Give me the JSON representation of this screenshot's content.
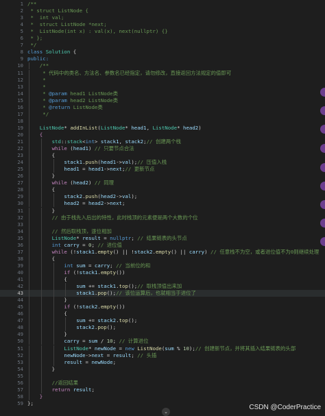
{
  "editor": {
    "current_line": 43,
    "lines": [
      {
        "n": 1,
        "indent": 0,
        "tokens": [
          [
            "/**",
            "cm"
          ]
        ]
      },
      {
        "n": 2,
        "indent": 0,
        "tokens": [
          [
            " * struct ListNode {",
            "cm"
          ]
        ]
      },
      {
        "n": 3,
        "indent": 0,
        "tokens": [
          [
            " *  int val;",
            "cm"
          ]
        ]
      },
      {
        "n": 4,
        "indent": 0,
        "tokens": [
          [
            " *  struct ListNode *next;",
            "cm"
          ]
        ]
      },
      {
        "n": 5,
        "indent": 0,
        "tokens": [
          [
            " *  ListNode(int x) : val(x), next(nullptr) {}",
            "cm"
          ]
        ]
      },
      {
        "n": 6,
        "indent": 0,
        "tokens": [
          [
            " * };",
            "cm"
          ]
        ]
      },
      {
        "n": 7,
        "indent": 0,
        "tokens": [
          [
            " */",
            "cm"
          ]
        ]
      },
      {
        "n": 8,
        "indent": 0,
        "tokens": [
          [
            "class ",
            "kw"
          ],
          [
            "Solution ",
            "ty"
          ],
          [
            "{",
            "pl"
          ]
        ]
      },
      {
        "n": 9,
        "indent": 0,
        "tokens": [
          [
            "public:",
            "kw"
          ]
        ]
      },
      {
        "n": 10,
        "indent": 1,
        "tokens": [
          [
            "    /**",
            "cm"
          ]
        ]
      },
      {
        "n": 11,
        "indent": 1,
        "tokens": [
          [
            "     * 代码中的类名、方法名、参数名已经指定，请勿修改，直接返回方法规定的值即可",
            "cm"
          ]
        ]
      },
      {
        "n": 12,
        "indent": 1,
        "tokens": [
          [
            "     *",
            "cm"
          ]
        ]
      },
      {
        "n": 13,
        "indent": 1,
        "tokens": [
          [
            "     *",
            "cm"
          ]
        ]
      },
      {
        "n": 14,
        "indent": 1,
        "tokens": [
          [
            "     * ",
            "cm"
          ],
          [
            "@param",
            "doc"
          ],
          [
            " head1 ListNode类",
            "cm"
          ]
        ]
      },
      {
        "n": 15,
        "indent": 1,
        "tokens": [
          [
            "     * ",
            "cm"
          ],
          [
            "@param",
            "doc"
          ],
          [
            " head2 ListNode类",
            "cm"
          ]
        ]
      },
      {
        "n": 16,
        "indent": 1,
        "tokens": [
          [
            "     * ",
            "cm"
          ],
          [
            "@return",
            "doc"
          ],
          [
            " ListNode类",
            "cm"
          ]
        ]
      },
      {
        "n": 17,
        "indent": 1,
        "tokens": [
          [
            "     */",
            "cm"
          ]
        ]
      },
      {
        "n": 18,
        "indent": 1,
        "tokens": []
      },
      {
        "n": 19,
        "indent": 1,
        "tokens": [
          [
            "    ListNode",
            "ty"
          ],
          [
            "* ",
            "pl"
          ],
          [
            "addInList",
            "fn"
          ],
          [
            "(",
            "pl"
          ],
          [
            "ListNode",
            "ty"
          ],
          [
            "* ",
            "pl"
          ],
          [
            "head1",
            "vr"
          ],
          [
            ", ",
            "pl"
          ],
          [
            "ListNode",
            "ty"
          ],
          [
            "* ",
            "pl"
          ],
          [
            "head2",
            "vr"
          ],
          [
            ")",
            "pl"
          ]
        ]
      },
      {
        "n": 20,
        "indent": 1,
        "tokens": [
          [
            "    {",
            "ct"
          ]
        ]
      },
      {
        "n": 21,
        "indent": 2,
        "tokens": [
          [
            "        std",
            "ty"
          ],
          [
            "::",
            "pl"
          ],
          [
            "stack",
            "ty"
          ],
          [
            "<",
            "pl"
          ],
          [
            "int",
            "kw"
          ],
          [
            "> ",
            "pl"
          ],
          [
            "stack1",
            "vr"
          ],
          [
            ", ",
            "pl"
          ],
          [
            "stack2",
            "vr"
          ],
          [
            ";",
            "pl"
          ],
          [
            "// 创建两个栈",
            "cm"
          ]
        ]
      },
      {
        "n": 22,
        "indent": 2,
        "tokens": [
          [
            "        while ",
            "ct"
          ],
          [
            "(",
            "pl"
          ],
          [
            "head1",
            "vr"
          ],
          [
            ") ",
            "pl"
          ],
          [
            "// 只要节点合法",
            "cm"
          ]
        ]
      },
      {
        "n": 23,
        "indent": 2,
        "tokens": [
          [
            "        {",
            "pl"
          ]
        ]
      },
      {
        "n": 24,
        "indent": 3,
        "tokens": [
          [
            "            stack1",
            "vr"
          ],
          [
            ".",
            "pl"
          ],
          [
            "push",
            "fn"
          ],
          [
            "(",
            "pl"
          ],
          [
            "head1",
            "vr"
          ],
          [
            "->",
            "pl"
          ],
          [
            "val",
            "vr"
          ],
          [
            ");",
            "pl"
          ],
          [
            "// 压值入栈",
            "cm"
          ]
        ]
      },
      {
        "n": 25,
        "indent": 3,
        "tokens": [
          [
            "            head1",
            "vr"
          ],
          [
            " = ",
            "pl"
          ],
          [
            "head1",
            "vr"
          ],
          [
            "->",
            "pl"
          ],
          [
            "next",
            "vr"
          ],
          [
            ";",
            "pl"
          ],
          [
            "// 更新节点",
            "cm"
          ]
        ]
      },
      {
        "n": 26,
        "indent": 2,
        "tokens": [
          [
            "        }",
            "pl"
          ]
        ]
      },
      {
        "n": 27,
        "indent": 2,
        "tokens": [
          [
            "        while ",
            "ct"
          ],
          [
            "(",
            "pl"
          ],
          [
            "head2",
            "vr"
          ],
          [
            ") ",
            "pl"
          ],
          [
            "// 同理",
            "cm"
          ]
        ]
      },
      {
        "n": 28,
        "indent": 2,
        "tokens": [
          [
            "        {",
            "pl"
          ]
        ]
      },
      {
        "n": 29,
        "indent": 3,
        "tokens": [
          [
            "            stack2",
            "vr"
          ],
          [
            ".",
            "pl"
          ],
          [
            "push",
            "fn"
          ],
          [
            "(",
            "pl"
          ],
          [
            "head2",
            "vr"
          ],
          [
            "->",
            "pl"
          ],
          [
            "val",
            "vr"
          ],
          [
            ");",
            "pl"
          ]
        ]
      },
      {
        "n": 30,
        "indent": 3,
        "tokens": [
          [
            "            head2",
            "vr"
          ],
          [
            " = ",
            "pl"
          ],
          [
            "head2",
            "vr"
          ],
          [
            "->",
            "pl"
          ],
          [
            "next",
            "vr"
          ],
          [
            ";",
            "pl"
          ]
        ]
      },
      {
        "n": 31,
        "indent": 2,
        "tokens": [
          [
            "        }",
            "pl"
          ]
        ]
      },
      {
        "n": 32,
        "indent": 2,
        "tokens": [
          [
            "        // 由于栈先入后出的特性，此时栈顶的元素便是两个大数的个位",
            "cm"
          ]
        ]
      },
      {
        "n": 33,
        "indent": 2,
        "tokens": []
      },
      {
        "n": 34,
        "indent": 2,
        "tokens": [
          [
            "        // 然后取栈顶，逐位相加",
            "cm"
          ]
        ]
      },
      {
        "n": 35,
        "indent": 2,
        "tokens": [
          [
            "        ListNode",
            "ty"
          ],
          [
            "* ",
            "pl"
          ],
          [
            "result",
            "vr"
          ],
          [
            " = ",
            "pl"
          ],
          [
            "nullptr",
            "kw"
          ],
          [
            "; ",
            "pl"
          ],
          [
            "// 结果链表的头节点",
            "cm"
          ]
        ]
      },
      {
        "n": 36,
        "indent": 2,
        "tokens": [
          [
            "        int ",
            "kw"
          ],
          [
            "carry",
            "vr"
          ],
          [
            " = ",
            "pl"
          ],
          [
            "0",
            "nm"
          ],
          [
            "; ",
            "pl"
          ],
          [
            "// 进位值",
            "cm"
          ]
        ]
      },
      {
        "n": 37,
        "indent": 2,
        "tokens": [
          [
            "        while ",
            "ct"
          ],
          [
            "(!",
            "pl"
          ],
          [
            "stack1",
            "vr"
          ],
          [
            ".",
            "pl"
          ],
          [
            "empty",
            "fn"
          ],
          [
            "() || !",
            "pl"
          ],
          [
            "stack2",
            "vr"
          ],
          [
            ".",
            "pl"
          ],
          [
            "empty",
            "fn"
          ],
          [
            "() || ",
            "pl"
          ],
          [
            "carry",
            "vr"
          ],
          [
            ") ",
            "pl"
          ],
          [
            "// 任意栈不为空，或者进位值不为0则继续处理",
            "cm"
          ]
        ]
      },
      {
        "n": 38,
        "indent": 2,
        "tokens": [
          [
            "        {",
            "pl"
          ]
        ]
      },
      {
        "n": 39,
        "indent": 3,
        "tokens": [
          [
            "            int ",
            "kw"
          ],
          [
            "sum",
            "vr"
          ],
          [
            " = ",
            "pl"
          ],
          [
            "carry",
            "vr"
          ],
          [
            "; ",
            "pl"
          ],
          [
            "// 当前位的和",
            "cm"
          ]
        ]
      },
      {
        "n": 40,
        "indent": 3,
        "tokens": [
          [
            "            if ",
            "ct"
          ],
          [
            "(!",
            "pl"
          ],
          [
            "stack1",
            "vr"
          ],
          [
            ".",
            "pl"
          ],
          [
            "empty",
            "fn"
          ],
          [
            "())",
            "pl"
          ]
        ]
      },
      {
        "n": 41,
        "indent": 3,
        "tokens": [
          [
            "            {",
            "pl"
          ]
        ]
      },
      {
        "n": 42,
        "indent": 4,
        "tokens": [
          [
            "                sum",
            "vr"
          ],
          [
            " += ",
            "pl"
          ],
          [
            "stack1",
            "vr"
          ],
          [
            ".",
            "pl"
          ],
          [
            "top",
            "fn"
          ],
          [
            "();",
            "pl"
          ],
          [
            "// 取栈顶值出来加",
            "cm"
          ]
        ]
      },
      {
        "n": 43,
        "indent": 4,
        "tokens": [
          [
            "                stack1",
            "vr"
          ],
          [
            ".",
            "pl"
          ],
          [
            "pop",
            "fn"
          ],
          [
            "();",
            "pl"
          ],
          [
            "// 该位运算后，也就相当于进位了",
            "cm"
          ]
        ]
      },
      {
        "n": 44,
        "indent": 3,
        "tokens": [
          [
            "            }",
            "pl"
          ]
        ]
      },
      {
        "n": 45,
        "indent": 3,
        "tokens": [
          [
            "            if ",
            "ct"
          ],
          [
            "(!",
            "pl"
          ],
          [
            "stack2",
            "vr"
          ],
          [
            ".",
            "pl"
          ],
          [
            "empty",
            "fn"
          ],
          [
            "())",
            "pl"
          ]
        ]
      },
      {
        "n": 46,
        "indent": 3,
        "tokens": [
          [
            "            {",
            "pl"
          ]
        ]
      },
      {
        "n": 47,
        "indent": 4,
        "tokens": [
          [
            "                sum",
            "vr"
          ],
          [
            " += ",
            "pl"
          ],
          [
            "stack2",
            "vr"
          ],
          [
            ".",
            "pl"
          ],
          [
            "top",
            "fn"
          ],
          [
            "();",
            "pl"
          ]
        ]
      },
      {
        "n": 48,
        "indent": 4,
        "tokens": [
          [
            "                stack2",
            "vr"
          ],
          [
            ".",
            "pl"
          ],
          [
            "pop",
            "fn"
          ],
          [
            "();",
            "pl"
          ]
        ]
      },
      {
        "n": 49,
        "indent": 3,
        "tokens": [
          [
            "            }",
            "pl"
          ]
        ]
      },
      {
        "n": 50,
        "indent": 3,
        "tokens": [
          [
            "            carry",
            "vr"
          ],
          [
            " = ",
            "pl"
          ],
          [
            "sum",
            "vr"
          ],
          [
            " / ",
            "pl"
          ],
          [
            "10",
            "nm"
          ],
          [
            "; ",
            "pl"
          ],
          [
            "// 计算进位",
            "cm"
          ]
        ]
      },
      {
        "n": 51,
        "indent": 3,
        "tokens": [
          [
            "            ListNode",
            "ty"
          ],
          [
            "* ",
            "pl"
          ],
          [
            "newNode",
            "vr"
          ],
          [
            " = ",
            "pl"
          ],
          [
            "new ",
            "kw"
          ],
          [
            "ListNode",
            "fn"
          ],
          [
            "(",
            "pl"
          ],
          [
            "sum",
            "vr"
          ],
          [
            " % ",
            "pl"
          ],
          [
            "10",
            "nm"
          ],
          [
            ");",
            "pl"
          ],
          [
            "// 创建新节点，并将其插入结果链表的头部",
            "cm"
          ]
        ]
      },
      {
        "n": 52,
        "indent": 3,
        "tokens": [
          [
            "            newNode",
            "vr"
          ],
          [
            "->",
            "pl"
          ],
          [
            "next",
            "vr"
          ],
          [
            " = ",
            "pl"
          ],
          [
            "result",
            "vr"
          ],
          [
            "; ",
            "pl"
          ],
          [
            "// 头插",
            "cm"
          ]
        ]
      },
      {
        "n": 53,
        "indent": 3,
        "tokens": [
          [
            "            result",
            "vr"
          ],
          [
            " = ",
            "pl"
          ],
          [
            "newNode",
            "vr"
          ],
          [
            ";",
            "pl"
          ]
        ]
      },
      {
        "n": 54,
        "indent": 2,
        "tokens": [
          [
            "        }",
            "pl"
          ]
        ]
      },
      {
        "n": 55,
        "indent": 2,
        "tokens": []
      },
      {
        "n": 56,
        "indent": 2,
        "tokens": [
          [
            "        //返回结果",
            "cm"
          ]
        ]
      },
      {
        "n": 57,
        "indent": 2,
        "tokens": [
          [
            "        return ",
            "ct"
          ],
          [
            "result",
            "vr"
          ],
          [
            ";",
            "pl"
          ]
        ]
      },
      {
        "n": 58,
        "indent": 1,
        "tokens": [
          [
            "    }",
            "ct"
          ]
        ]
      },
      {
        "n": 59,
        "indent": 0,
        "tokens": [
          [
            "};",
            "pl"
          ]
        ]
      }
    ]
  },
  "side_markers_count": 9,
  "watermark": "CSDN @CoderPractice",
  "scroll_indicator_icon": "chevron-down-icon",
  "scroll_indicator_glyph": "⌄",
  "colors": {
    "background": "#1e1e1e",
    "comment": "#6a9955",
    "keyword": "#569cd6",
    "control": "#c586c0",
    "type": "#4ec9b0",
    "function": "#dcdcaa",
    "variable": "#9cdcfe",
    "number": "#b5cea8",
    "marker": "#6c3e8e"
  }
}
